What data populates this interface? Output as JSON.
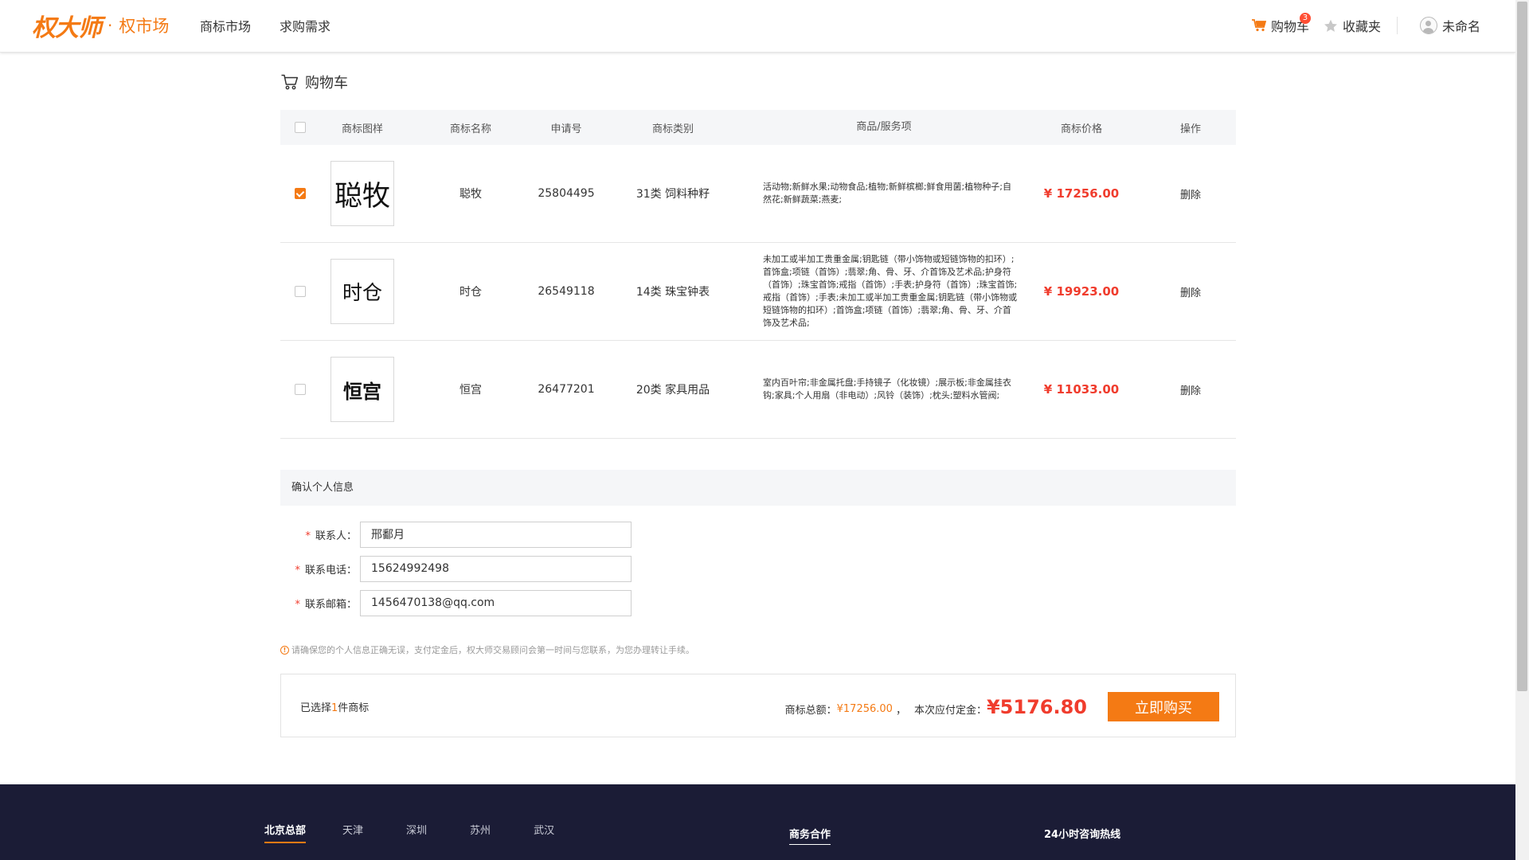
{
  "header": {
    "logo_main": "权大师",
    "logo_dot": "·",
    "logo_sub": "权市场",
    "nav": [
      "商标市场",
      "求购需求"
    ],
    "cart_label": "购物车",
    "cart_count": "3",
    "favorites_label": "收藏夹",
    "user_name": "未命名"
  },
  "page": {
    "title": "购物车"
  },
  "table": {
    "headers": [
      "商标图样",
      "商标名称",
      "申请号",
      "商标类别",
      "商品/服务项",
      "商标价格",
      "操作"
    ],
    "rows": [
      {
        "checked": true,
        "image_text": "聪牧",
        "name": "聪牧",
        "app_no": "25804495",
        "category": "31类 饲料种籽",
        "goods": "活动物;新鲜水果;动物食品;植物;新鲜槟榔;鲜食用菌;植物种子;自然花;新鲜蔬菜;燕麦;",
        "price": "¥ 17256.00",
        "op": "删除"
      },
      {
        "checked": false,
        "image_text": "时仓",
        "name": "时仓",
        "app_no": "26549118",
        "category": "14类 珠宝钟表",
        "goods": "未加工或半加工贵重金属;钥匙链（带小饰物或短链饰物的扣环）;首饰盒;项链（首饰）;翡翠;角、骨、牙、介首饰及艺术品;护身符（首饰）;珠宝首饰;戒指（首饰）;手表;护身符（首饰）;珠宝首饰;戒指（首饰）;手表;未加工或半加工贵重金属;钥匙链（带小饰物或短链饰物的扣环）;首饰盒;项链（首饰）;翡翠;角、骨、牙、介首饰及艺术品;",
        "price": "¥ 19923.00",
        "op": "删除"
      },
      {
        "checked": false,
        "image_text": "恒宫",
        "name": "恒宫",
        "app_no": "26477201",
        "category": "20类 家具用品",
        "goods": "室内百叶帘;非金属托盘;手持镜子（化妆镜）;展示板;非金属挂衣钩;家具;个人用扇（非电动）;风铃（装饰）;枕头;塑料水管阀;",
        "price": "¥ 11033.00",
        "op": "删除"
      }
    ]
  },
  "info": {
    "section_title": "确认个人信息",
    "required_mark": "*",
    "contact_label": "联系人：",
    "contact_value": "邢鄱月",
    "phone_label": "联系电话：",
    "phone_value": "15624992498",
    "email_label": "联系邮箱：",
    "email_value": "1456470138@qq.com",
    "notice_icon": "!",
    "notice": "请确保您的个人信息正确无误，支付定金后，权大师交易顾问会第一时间与您联系，为您办理转让手续。"
  },
  "summary": {
    "selected_prefix": "已选择",
    "selected_count": "1",
    "selected_suffix": "件商标",
    "total_label": "商标总额：",
    "total_value": "¥17256.00",
    "sep": "，",
    "deposit_label": "本次应付定金：",
    "deposit_value": "¥5176.80",
    "buy_label": "立即购买"
  },
  "footer": {
    "cities": [
      "北京总部",
      "天津",
      "深圳",
      "苏州",
      "武汉"
    ],
    "business": "商务合作",
    "hotline": "24小时咨询热线"
  },
  "colors": {
    "accent": "#f47a14",
    "price": "#f03c2d",
    "footer_bg": "#1b1c36"
  }
}
